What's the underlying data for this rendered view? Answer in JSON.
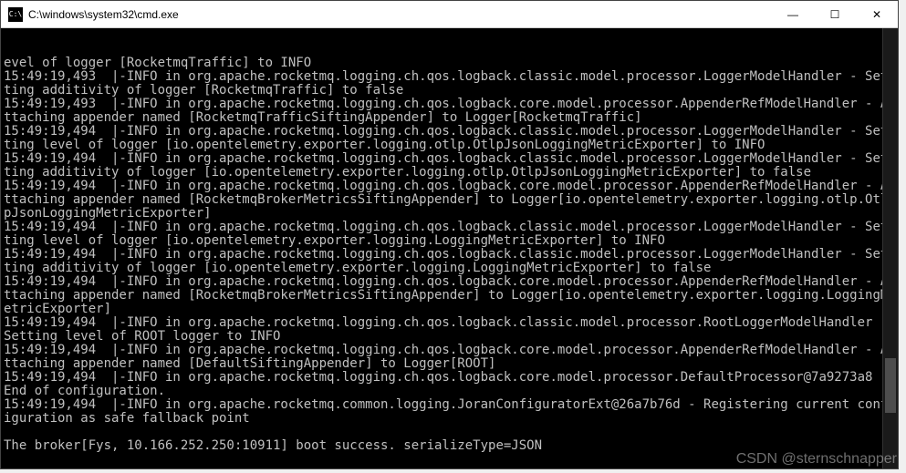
{
  "window": {
    "title": "C:\\windows\\system32\\cmd.exe",
    "icon_label": "C:\\"
  },
  "controls": {
    "minimize": "—",
    "maximize": "☐",
    "close": "✕"
  },
  "watermark": "CSDN @sternschnapper",
  "log_lines": [
    "evel of logger [RocketmqTraffic] to INFO",
    "15:49:19,493  |-INFO in org.apache.rocketmq.logging.ch.qos.logback.classic.model.processor.LoggerModelHandler - Setting additivity of logger [RocketmqTraffic] to false",
    "15:49:19,493  |-INFO in org.apache.rocketmq.logging.ch.qos.logback.core.model.processor.AppenderRefModelHandler - Attaching appender named [RocketmqTrafficSiftingAppender] to Logger[RocketmqTraffic]",
    "15:49:19,494  |-INFO in org.apache.rocketmq.logging.ch.qos.logback.classic.model.processor.LoggerModelHandler - Setting level of logger [io.opentelemetry.exporter.logging.otlp.OtlpJsonLoggingMetricExporter] to INFO",
    "15:49:19,494  |-INFO in org.apache.rocketmq.logging.ch.qos.logback.classic.model.processor.LoggerModelHandler - Setting additivity of logger [io.opentelemetry.exporter.logging.otlp.OtlpJsonLoggingMetricExporter] to false",
    "15:49:19,494  |-INFO in org.apache.rocketmq.logging.ch.qos.logback.core.model.processor.AppenderRefModelHandler - Attaching appender named [RocketmqBrokerMetricsSiftingAppender] to Logger[io.opentelemetry.exporter.logging.otlp.OtlpJsonLoggingMetricExporter]",
    "15:49:19,494  |-INFO in org.apache.rocketmq.logging.ch.qos.logback.classic.model.processor.LoggerModelHandler - Setting level of logger [io.opentelemetry.exporter.logging.LoggingMetricExporter] to INFO",
    "15:49:19,494  |-INFO in org.apache.rocketmq.logging.ch.qos.logback.classic.model.processor.LoggerModelHandler - Setting additivity of logger [io.opentelemetry.exporter.logging.LoggingMetricExporter] to false",
    "15:49:19,494  |-INFO in org.apache.rocketmq.logging.ch.qos.logback.core.model.processor.AppenderRefModelHandler - Attaching appender named [RocketmqBrokerMetricsSiftingAppender] to Logger[io.opentelemetry.exporter.logging.LoggingMetricExporter]",
    "15:49:19,494  |-INFO in org.apache.rocketmq.logging.ch.qos.logback.classic.model.processor.RootLoggerModelHandler - Setting level of ROOT logger to INFO",
    "15:49:19,494  |-INFO in org.apache.rocketmq.logging.ch.qos.logback.core.model.processor.AppenderRefModelHandler - Attaching appender named [DefaultSiftingAppender] to Logger[ROOT]",
    "15:49:19,494  |-INFO in org.apache.rocketmq.logging.ch.qos.logback.core.model.processor.DefaultProcessor@7a9273a8 - End of configuration.",
    "15:49:19,494  |-INFO in org.apache.rocketmq.common.logging.JoranConfiguratorExt@26a7b76d - Registering current configuration as safe fallback point",
    "",
    "The broker[Fys, 10.166.252.250:10911] boot success. serializeType=JSON"
  ]
}
